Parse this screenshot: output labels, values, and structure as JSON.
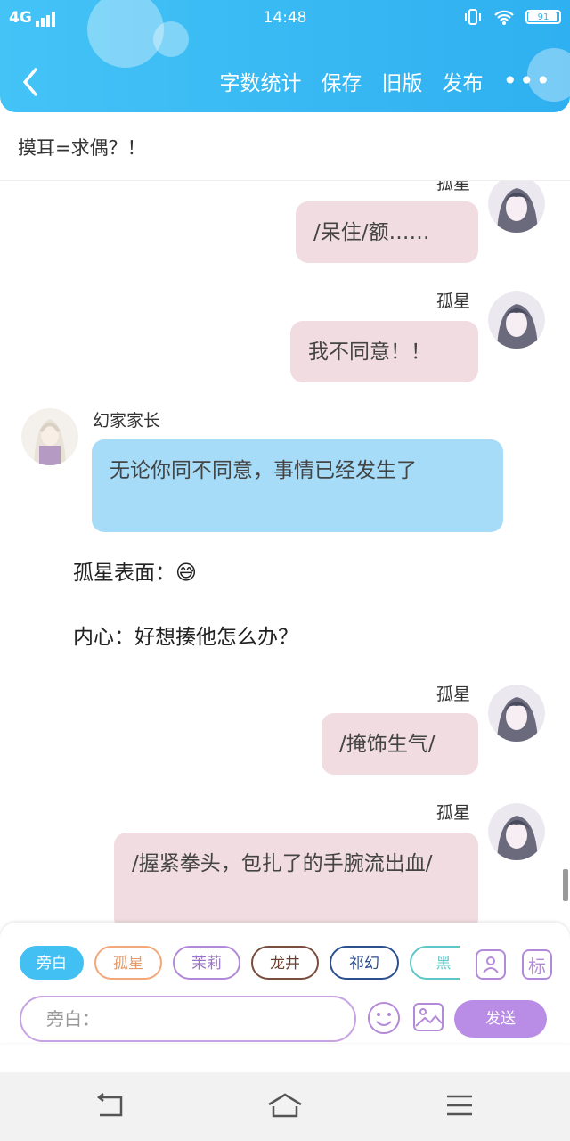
{
  "status": {
    "network": "4G",
    "time": "14:48",
    "battery": "91"
  },
  "header": {
    "actions": [
      "字数统计",
      "保存",
      "旧版",
      "发布"
    ],
    "more": "•••"
  },
  "notice": "摸耳=求偶？！",
  "messages": [
    {
      "type": "right",
      "name": "孤星",
      "text": "/呆住/额……"
    },
    {
      "type": "right",
      "name": "孤星",
      "text": "我不同意！！"
    },
    {
      "type": "left",
      "name": "幻家家长",
      "text": "无论你同不同意，事情已经发生了"
    },
    {
      "type": "narration",
      "text": "孤星表面：😅"
    },
    {
      "type": "narration",
      "text": "内心：好想揍他怎么办？"
    },
    {
      "type": "right",
      "name": "孤星",
      "text": "/掩饰生气/"
    },
    {
      "type": "right",
      "name": "孤星",
      "text": "/握紧拳头，包扎了的手腕流出血/"
    }
  ],
  "composer": {
    "chips": [
      {
        "label": "旁白",
        "color": "#3fb6f0",
        "filled": true
      },
      {
        "label": "孤星",
        "color": "#f3a77a",
        "filled": false
      },
      {
        "label": "茉莉",
        "color": "#b08ad6",
        "filled": false
      },
      {
        "label": "龙井",
        "color": "#7a4e3c",
        "filled": false
      },
      {
        "label": "祁幻",
        "color": "#2c4f8f",
        "filled": false
      },
      {
        "label": "黑",
        "color": "#5fc6c6",
        "filled": false
      }
    ],
    "tool_icons": [
      "contact-icon",
      "tag-icon"
    ],
    "tag_label": "标",
    "input_placeholder": "旁白：",
    "send_label": "发送"
  }
}
